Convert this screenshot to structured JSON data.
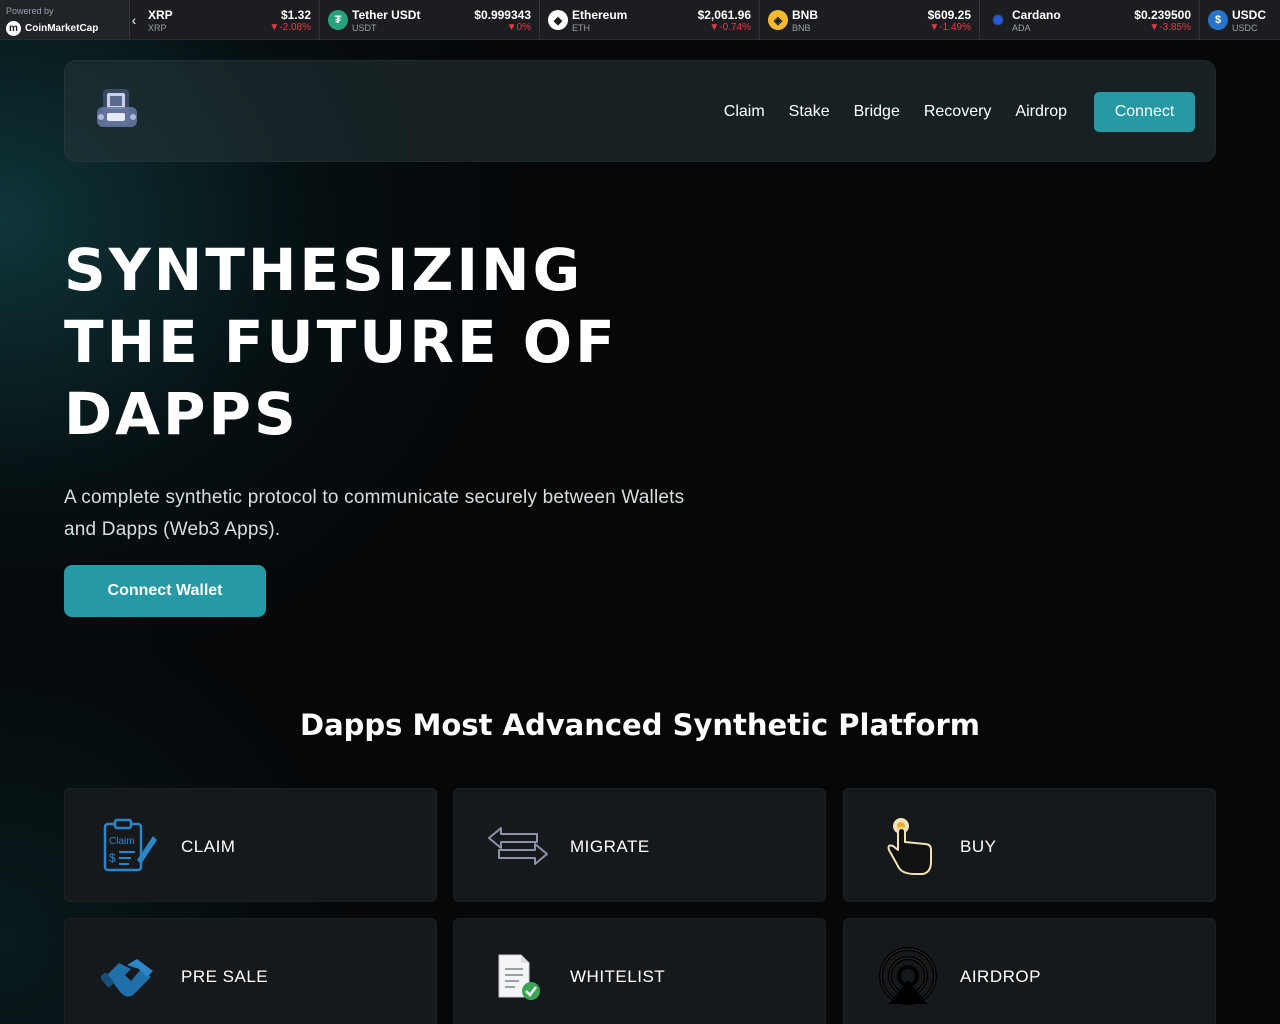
{
  "ticker": {
    "powered_by": "Powered by",
    "brand": "CoinMarketCap",
    "coins": [
      {
        "name": "XRP",
        "symbol": "XRP",
        "price": "$1.32",
        "change": "▼-2.08%",
        "icon": "xrp-icon",
        "color": "#23292f"
      },
      {
        "name": "Tether USDt",
        "symbol": "USDT",
        "price": "$0.999343",
        "change": "▼0%",
        "icon": "tether-icon",
        "color": "#26a17b"
      },
      {
        "name": "Ethereum",
        "symbol": "ETH",
        "price": "$2,061.96",
        "change": "▼-0.74%",
        "icon": "ethereum-icon",
        "color": "#ffffff"
      },
      {
        "name": "BNB",
        "symbol": "BNB",
        "price": "$609.25",
        "change": "▼-1.49%",
        "icon": "bnb-icon",
        "color": "#f3ba2f"
      },
      {
        "name": "Cardano",
        "symbol": "ADA",
        "price": "$0.239500",
        "change": "▼-3.85%",
        "icon": "cardano-icon",
        "color": "#0033ad"
      },
      {
        "name": "USDC",
        "symbol": "USDC",
        "price": "",
        "change": "",
        "icon": "usdc-icon",
        "color": "#2775ca"
      }
    ]
  },
  "nav": {
    "links": [
      "Claim",
      "Stake",
      "Bridge",
      "Recovery",
      "Airdrop"
    ],
    "connect_label": "Connect"
  },
  "hero": {
    "title_lines": [
      "SYNTHESIZING",
      "THE FUTURE OF",
      "DAPPS"
    ],
    "subtitle": "A complete synthetic protocol to communicate securely between Wallets and Dapps (Web3 Apps).",
    "cta_label": "Connect Wallet"
  },
  "features": {
    "title": "Dapps Most Advanced Synthetic Platform",
    "cards": [
      {
        "label": "CLAIM",
        "icon": "claim-clipboard-icon"
      },
      {
        "label": "MIGRATE",
        "icon": "migrate-arrows-icon"
      },
      {
        "label": "BUY",
        "icon": "buy-hand-icon"
      },
      {
        "label": "PRE SALE",
        "icon": "handshake-icon"
      },
      {
        "label": "WHITELIST",
        "icon": "whitelist-document-icon"
      },
      {
        "label": "AIRDROP",
        "icon": "airdrop-signal-icon"
      }
    ]
  },
  "colors": {
    "accent": "#2599a4",
    "negative": "#ea3943",
    "card_bg": "#16191c"
  }
}
